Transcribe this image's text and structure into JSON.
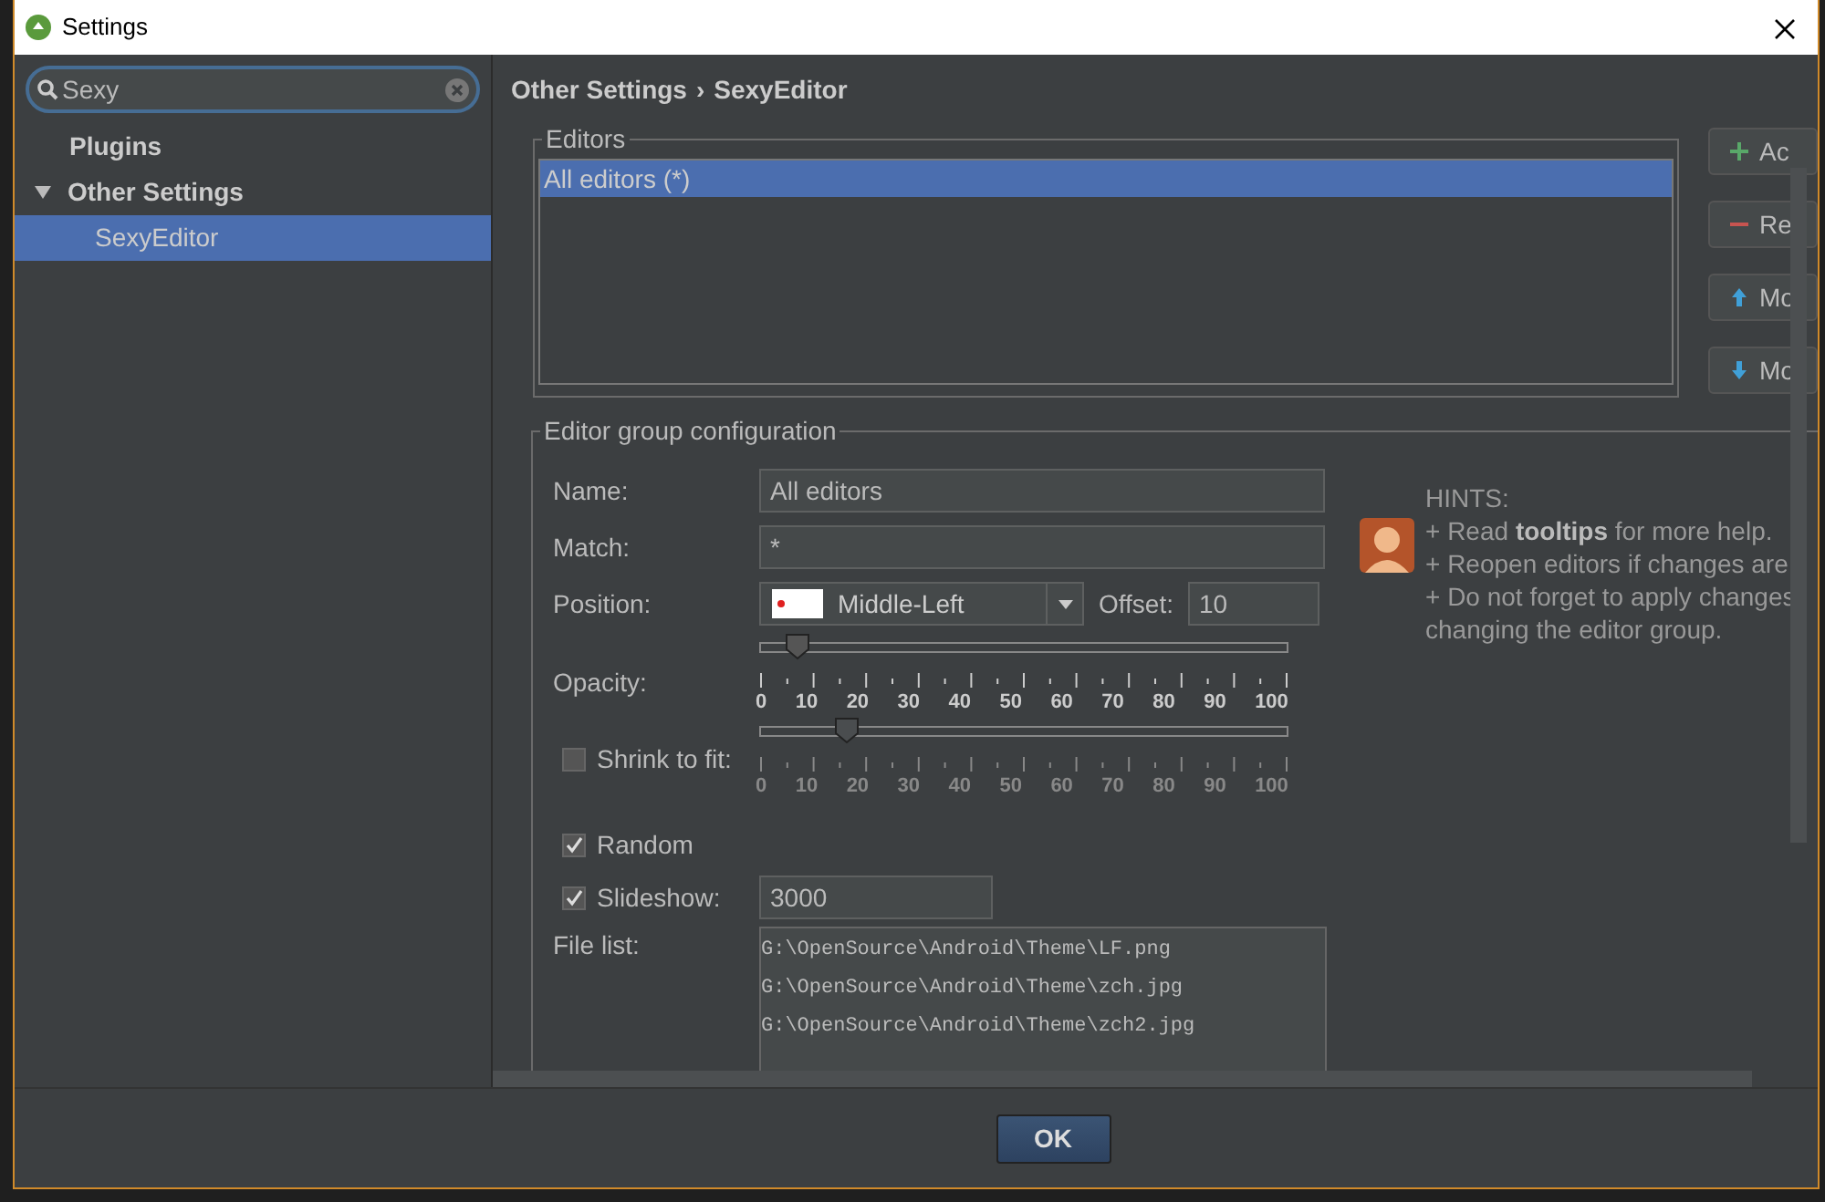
{
  "window": {
    "title": "Settings"
  },
  "search": {
    "value": "Sexy"
  },
  "sidebar": {
    "items": [
      {
        "label": "Plugins",
        "selected": false
      },
      {
        "label": "Other Settings",
        "selected": false,
        "expanded": true,
        "children": [
          {
            "label": "SexyEditor",
            "selected": true
          }
        ]
      }
    ]
  },
  "breadcrumb": {
    "parts": [
      "Other Settings",
      "SexyEditor"
    ],
    "separator": "›"
  },
  "editors": {
    "title": "Editors",
    "items": [
      {
        "label": "All editors (*)",
        "selected": true
      }
    ]
  },
  "side_buttons": [
    {
      "kind": "add",
      "label": "Ac"
    },
    {
      "kind": "remove",
      "label": "Re"
    },
    {
      "kind": "up",
      "label": "Mo"
    },
    {
      "kind": "down",
      "label": "Mo"
    }
  ],
  "config": {
    "title": "Editor group configuration",
    "name": {
      "label": "Name:",
      "value": "All editors"
    },
    "match": {
      "label": "Match:",
      "value": "*"
    },
    "position": {
      "label": "Position:",
      "value": "Middle-Left"
    },
    "offset": {
      "label": "Offset:",
      "value": "10"
    },
    "opacity": {
      "label": "Opacity:",
      "level": 0.05,
      "ticks": [
        "0",
        "10",
        "20",
        "30",
        "40",
        "50",
        "60",
        "70",
        "80",
        "90",
        "100"
      ]
    },
    "shrink": {
      "label": "Shrink to fit:",
      "checked": false,
      "level": 0.15,
      "ticks": [
        "0",
        "10",
        "20",
        "30",
        "40",
        "50",
        "60",
        "70",
        "80",
        "90",
        "100"
      ]
    },
    "random": {
      "label": "Random",
      "checked": true
    },
    "slideshow": {
      "label": "Slideshow:",
      "checked": true,
      "value": "3000"
    },
    "file_list": {
      "label": "File list:",
      "files": [
        "G:\\OpenSource\\Android\\Theme\\LF.png",
        "G:\\OpenSource\\Android\\Theme\\zch.jpg",
        "G:\\OpenSource\\Android\\Theme\\zch2.jpg"
      ]
    }
  },
  "hints": {
    "title": "HINTS:",
    "lines": [
      "+ Read **tooltips** for more help.",
      "+ Reopen editors if changes are",
      "+ Do not forget to apply changes",
      "changing the editor group."
    ]
  },
  "buttons": [
    {
      "label": "OK"
    }
  ]
}
